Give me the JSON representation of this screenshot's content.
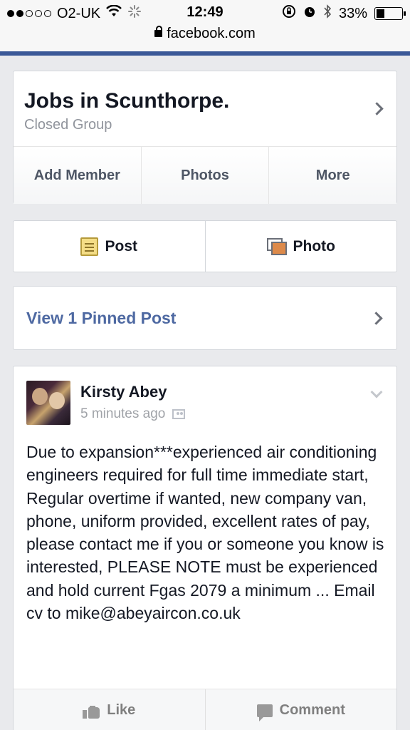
{
  "status_bar": {
    "carrier": "O2-UK",
    "time": "12:49",
    "battery": "33%",
    "battery_level": 0.33,
    "signal_bars": 2
  },
  "browser": {
    "url": "facebook.com"
  },
  "group": {
    "title": "Jobs in Scunthorpe.",
    "privacy": "Closed Group",
    "actions": [
      "Add Member",
      "Photos",
      "More"
    ]
  },
  "composer": {
    "post_label": "Post",
    "photo_label": "Photo"
  },
  "pinned": {
    "label": "View 1 Pinned Post"
  },
  "post": {
    "author": "Kirsty Abey",
    "time": "5 minutes ago",
    "body": "Due to expansion***experienced air conditioning engineers required for full time immediate start,\nRegular overtime if wanted, new company van, phone, uniform provided, excellent rates of pay, please contact me if you or someone you know is interested, PLEASE NOTE must be experienced and hold current Fgas 2079 a minimum ... Email cv to mike@abeyaircon.co.uk",
    "like_label": "Like",
    "comment_label": "Comment"
  },
  "colors": {
    "facebook_blue": "#3b5998",
    "link": "#4e69a2"
  }
}
